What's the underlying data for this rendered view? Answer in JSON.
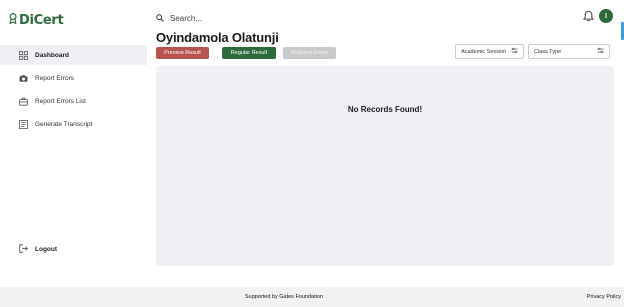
{
  "brand": {
    "name": "DiCert",
    "color": "#2e6b3c"
  },
  "header": {
    "search_placeholder": "Search...",
    "avatar_initial": "I",
    "icons": [
      "search-icon",
      "bell-icon"
    ]
  },
  "sidebar": {
    "items": [
      {
        "label": "Dashboard",
        "icon": "dashboard-icon",
        "active": true
      },
      {
        "label": "Report Errors",
        "icon": "camera-icon",
        "active": false
      },
      {
        "label": "Report Errors List",
        "icon": "toolbox-icon",
        "active": false
      },
      {
        "label": "Generate Transcript",
        "icon": "transcript-icon",
        "active": false
      }
    ],
    "logout_label": "Logout"
  },
  "main": {
    "student_name": "Oyindamola Olatunji",
    "buttons": {
      "preview": "Preview Result",
      "regular": "Regular Result",
      "regional": "Regional Exam"
    },
    "filters": {
      "academic_session": "Academic Session",
      "class_type": "Class Type"
    },
    "empty_message": "No Records Found!"
  },
  "footer": {
    "credit": "Supported by Gates Foundation",
    "privacy_link": "Privacy Policy"
  },
  "colors": {
    "preview_button": "#b85450",
    "regular_button": "#2e6b3c",
    "regional_button_disabled": "#c9c9c9",
    "panel_background": "#eef0f3"
  }
}
